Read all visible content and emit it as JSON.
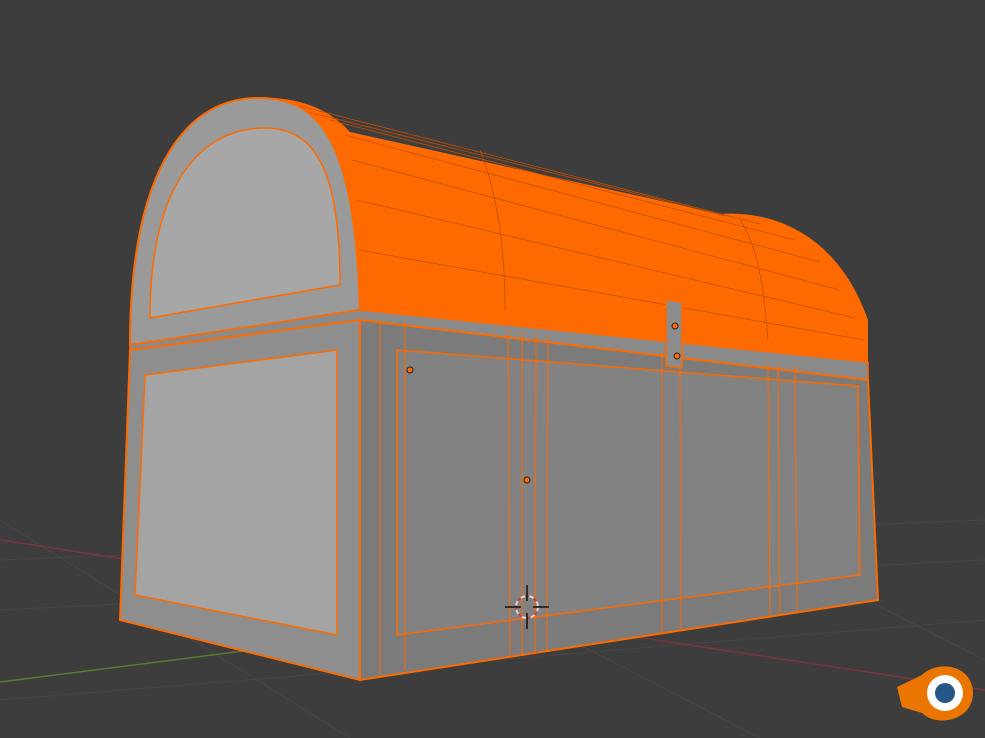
{
  "viewport": {
    "background": "#3d3d3d",
    "grid_color": "#4a4a4a",
    "x_axis_color": "#8a3a45",
    "y_axis_color": "#5b7a2e"
  },
  "object": {
    "mesh_color": "#8f8f8f",
    "mesh_color_dark": "#7a7a7a",
    "mesh_color_light": "#a3a3a3",
    "wire_color": "#ff6a00",
    "selected": true,
    "mode": "edit"
  },
  "cursor": {
    "icon": "3d-cursor-icon"
  },
  "branding": {
    "icon": "blender-logo-icon",
    "color": "#ea7600",
    "eye_color": "#265787"
  }
}
